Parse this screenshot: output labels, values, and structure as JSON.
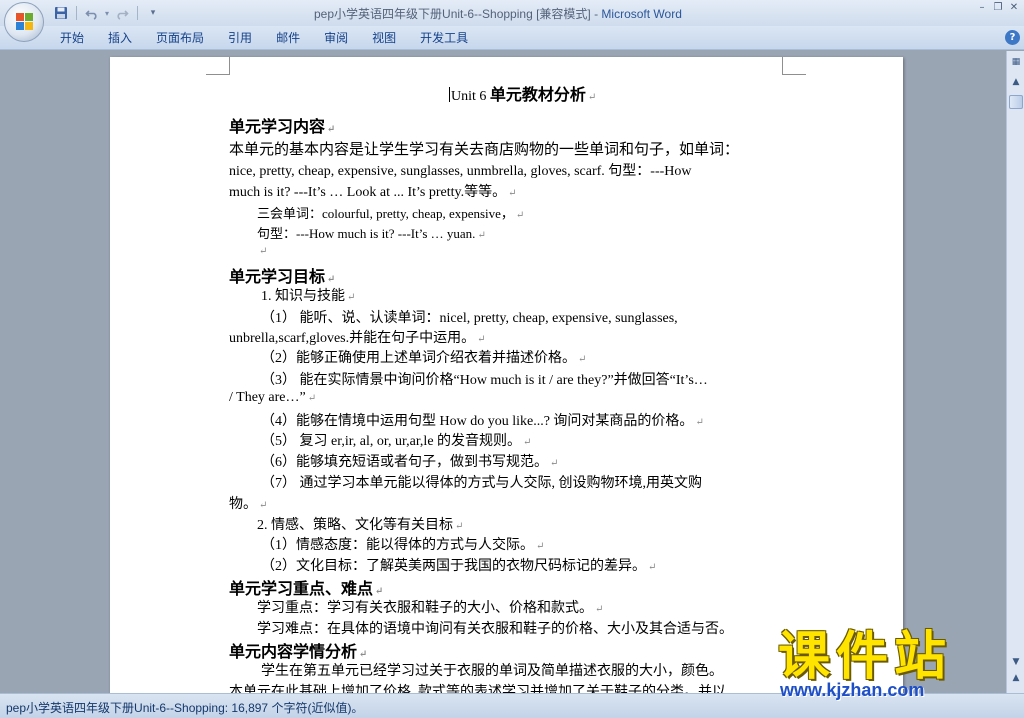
{
  "window": {
    "title": "pep小学英语四年级下册Unit-6--Shopping [兼容模式] - ",
    "app_name": "Microsoft Word"
  },
  "qat": {
    "icons": [
      "save-icon",
      "undo-icon",
      "redo-icon",
      "customize-icon"
    ]
  },
  "ribbon": {
    "tabs": [
      {
        "label": "开始"
      },
      {
        "label": "插入"
      },
      {
        "label": "页面布局"
      },
      {
        "label": "引用"
      },
      {
        "label": "邮件"
      },
      {
        "label": "审阅"
      },
      {
        "label": "视图"
      },
      {
        "label": "开发工具"
      }
    ],
    "help_label": "?"
  },
  "document": {
    "title_en": "Unit 6 ",
    "title_cn": "单元教材分析",
    "pilcrow": "↵",
    "sections": {
      "content_heading": "单元学习内容",
      "content_p1_a": "本单元的基本内容是让学生学习有关去商店购物的一些单词和句子，如单词：",
      "content_p1_b": "nice, pretty, cheap, expensive, sunglasses, unmbrella, gloves, scarf. 句型：---How",
      "content_p1_c": "much is it? ---It’s … Look at ... It’s pretty.等等。",
      "words_line": "三会单词：colourful, pretty, cheap, expensive，",
      "sentence_line": "句型：---How much is it? ---It’s … yuan.",
      "goals_heading": "单元学习目标",
      "goal_1": "1. 知识与技能",
      "goal_1_1a": "（1） 能听、说、认读单词：nicel, pretty, cheap, expensive, sunglasses,",
      "goal_1_1b": "unbrella,scarf,gloves.并能在句子中运用。",
      "goal_1_2": "（2）能够正确使用上述单词介绍衣着并描述价格。",
      "goal_1_3a": "（3） 能在实际情景中询问价格“How much is it / are they?”并做回答“It’s…",
      "goal_1_3b": "/ They are…”",
      "goal_1_4": "（4）能够在情境中运用句型 How do you like...? 询问对某商品的价格。",
      "goal_1_5": "（5） 复习 er,ir, al, or, ur,ar,le 的发音规则。",
      "goal_1_6": "（6）能够填充短语或者句子，做到书写规范。",
      "goal_1_7a": "（7） 通过学习本单元能以得体的方式与人交际, 创设购物环境,用英文购",
      "goal_1_7b": "物。",
      "goal_2": "2. 情感、策略、文化等有关目标",
      "goal_2_1": "（1）情感态度：能以得体的方式与人交际。",
      "goal_2_2": "（2）文化目标：了解英美两国于我国的衣物尺码标记的差异。",
      "key_heading": "单元学习重点、难点",
      "key_point": "学习重点：学习有关衣服和鞋子的大小、价格和款式。",
      "difficult_point": "学习难点：在具体的语境中询问有关衣服和鞋子的价格、大小及其合适与否。",
      "analysis_heading": "单元内容学情分析",
      "analysis_a": "学生在第五单元已经学习过关于衣服的单词及简单描述衣服的大小，颜色。",
      "analysis_b": "本单元在此基础上增加了价格, 款式等的表述学习并增加了关于鞋子的分类。并以"
    }
  },
  "status": {
    "text": "pep小学英语四年级下册Unit-6--Shopping: 16,897 个字符(近似值)。"
  },
  "watermark": {
    "brand": "课件站",
    "url": "www.kjzhan.com"
  },
  "colors": {
    "ribbon_text": "#15428b",
    "app_name": "#2b579a",
    "workspace": "#9aa5b4",
    "watermark_yellow": "#ffe400",
    "watermark_blue": "#1e4fc7"
  }
}
